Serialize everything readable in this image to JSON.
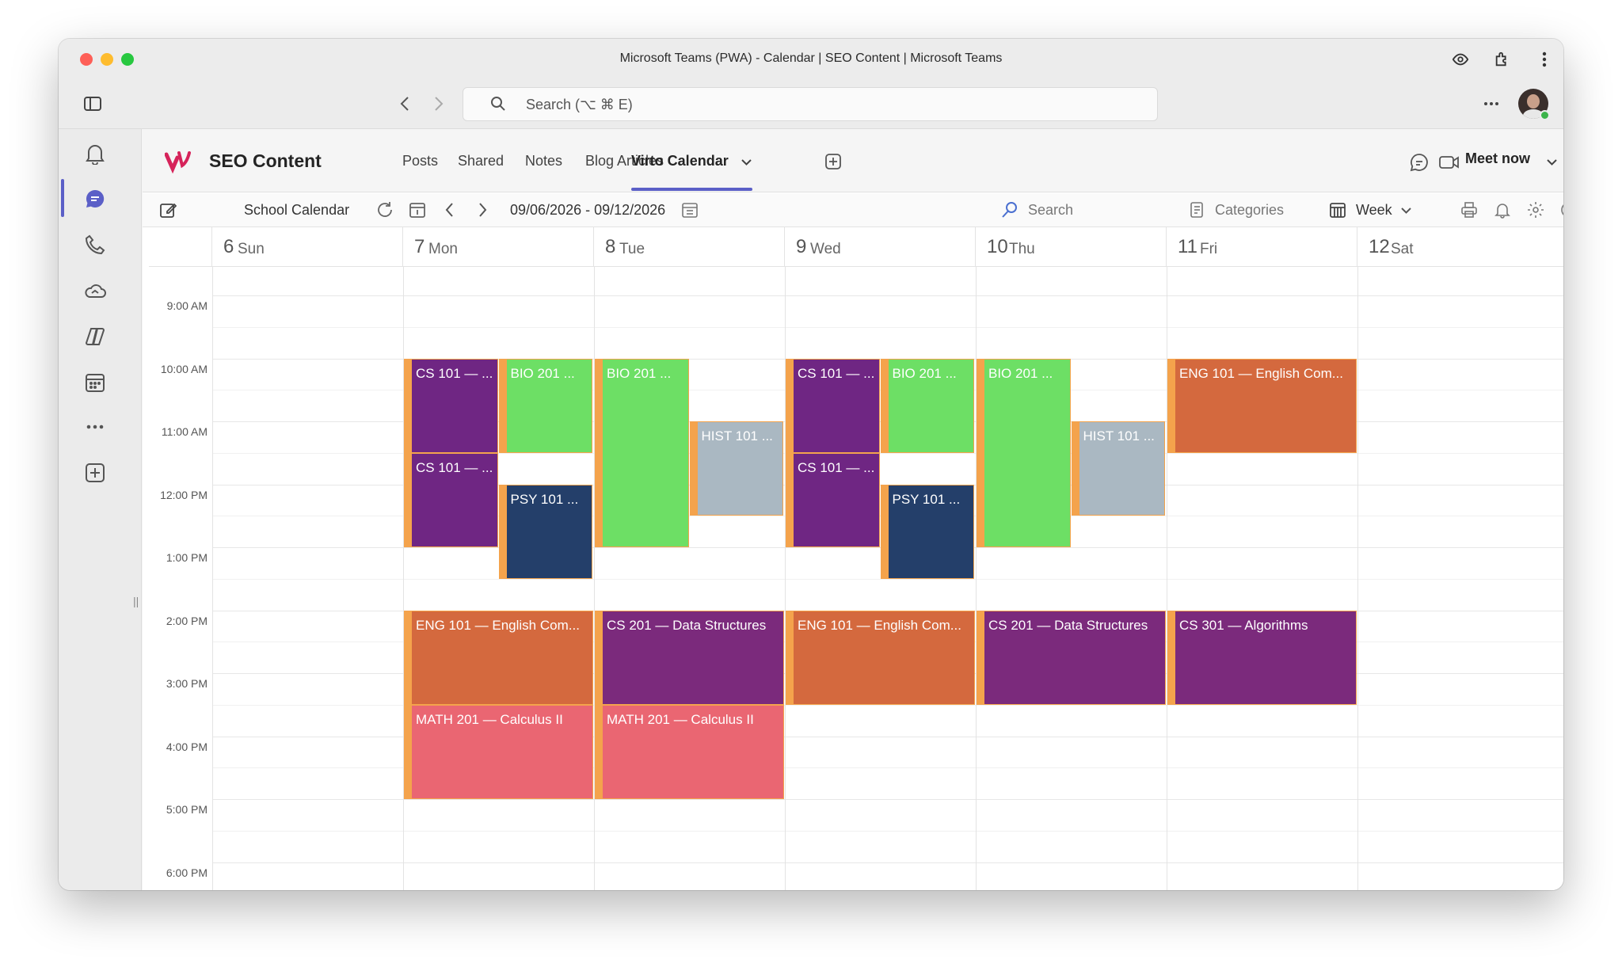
{
  "window": {
    "title": "Microsoft Teams (PWA) - Calendar | SEO Content | Microsoft Teams"
  },
  "browser": {
    "search_placeholder": "Search (⌥ ⌘ E)"
  },
  "team": {
    "name": "SEO Content"
  },
  "tabs": [
    {
      "label": "Posts"
    },
    {
      "label": "Shared"
    },
    {
      "label": "Notes"
    },
    {
      "label": "Blog Articles"
    },
    {
      "label": "Virto Calendar"
    }
  ],
  "header": {
    "meet_now": "Meet now"
  },
  "calendar": {
    "name": "School Calendar",
    "date_range": "09/06/2026 - 09/12/2026",
    "search": "Search",
    "categories": "Categories",
    "view": "Week",
    "days": [
      {
        "num": "6",
        "name": "Sun"
      },
      {
        "num": "7",
        "name": "Mon"
      },
      {
        "num": "8",
        "name": "Tue"
      },
      {
        "num": "9",
        "name": "Wed"
      },
      {
        "num": "10",
        "name": "Thu"
      },
      {
        "num": "11",
        "name": "Fri"
      },
      {
        "num": "12",
        "name": "Sat"
      }
    ],
    "times": [
      "9:00 AM",
      "10:00 AM",
      "11:00 AM",
      "12:00 PM",
      "1:00 PM",
      "2:00 PM",
      "3:00 PM",
      "4:00 PM",
      "5:00 PM",
      "6:00 PM"
    ],
    "events": [
      {
        "title": "CS 101 — ...",
        "day": 1,
        "start": "10:00",
        "end": "11:30",
        "color": "#6f2683"
      },
      {
        "title": "BIO 201 ...",
        "day": 1,
        "start": "10:00",
        "end": "11:30",
        "color": "#6ddf65"
      },
      {
        "title": "CS 101 — ...",
        "day": 1,
        "start": "11:30",
        "end": "13:00",
        "color": "#6f2683"
      },
      {
        "title": "PSY 101 ...",
        "day": 1,
        "start": "12:00",
        "end": "13:30",
        "color": "#243f6a"
      },
      {
        "title": "ENG 101 — English Com...",
        "day": 1,
        "start": "14:00",
        "end": "15:30",
        "color": "#d4693e"
      },
      {
        "title": "MATH 201 — Calculus II",
        "day": 1,
        "start": "15:30",
        "end": "17:00",
        "color": "#ea6672"
      },
      {
        "title": "BIO 201 ...",
        "day": 2,
        "start": "10:00",
        "end": "13:00",
        "color": "#6ddf65"
      },
      {
        "title": "HIST 101 ...",
        "day": 2,
        "start": "11:00",
        "end": "12:30",
        "color": "#aab8c2"
      },
      {
        "title": "CS 201 — Data Structures",
        "day": 2,
        "start": "14:00",
        "end": "15:30",
        "color": "#7b2a7c"
      },
      {
        "title": "MATH 201 — Calculus II",
        "day": 2,
        "start": "15:30",
        "end": "17:00",
        "color": "#ea6672"
      },
      {
        "title": "CS 101 — ...",
        "day": 3,
        "start": "10:00",
        "end": "11:30",
        "color": "#6f2683"
      },
      {
        "title": "BIO 201 ...",
        "day": 3,
        "start": "10:00",
        "end": "11:30",
        "color": "#6ddf65"
      },
      {
        "title": "CS 101 — ...",
        "day": 3,
        "start": "11:30",
        "end": "13:00",
        "color": "#6f2683"
      },
      {
        "title": "PSY 101 ...",
        "day": 3,
        "start": "12:00",
        "end": "13:30",
        "color": "#243f6a"
      },
      {
        "title": "ENG 101 — English Com...",
        "day": 3,
        "start": "14:00",
        "end": "15:30",
        "color": "#d4693e"
      },
      {
        "title": "BIO 201 ...",
        "day": 4,
        "start": "10:00",
        "end": "13:00",
        "color": "#6ddf65"
      },
      {
        "title": "HIST 101 ...",
        "day": 4,
        "start": "11:00",
        "end": "12:30",
        "color": "#aab8c2"
      },
      {
        "title": "CS 201 — Data Structures",
        "day": 4,
        "start": "14:00",
        "end": "15:30",
        "color": "#7b2a7c"
      },
      {
        "title": "ENG 101 — English Com...",
        "day": 5,
        "start": "10:00",
        "end": "11:30",
        "color": "#d4693e"
      },
      {
        "title": "CS 301 — Algorithms",
        "day": 5,
        "start": "14:00",
        "end": "15:30",
        "color": "#7b2a7c"
      }
    ]
  }
}
